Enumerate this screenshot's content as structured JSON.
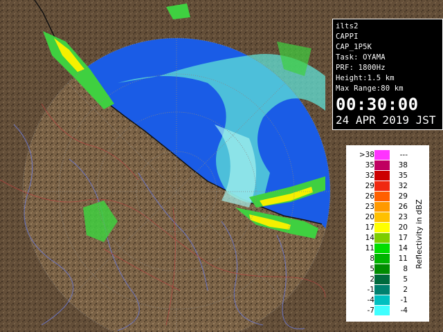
{
  "info": {
    "site": "ilts2",
    "product": "CAPPI",
    "scan": "CAP_1P5K",
    "task": "Task: OYAMA",
    "prf": "PRF: 1800Hz",
    "height": "Height:1.5 km",
    "max_range": "Max Range:80 km",
    "time": "00:30:00",
    "date": "24 APR 2019 JST"
  },
  "legend": {
    "title": "Reflectivity in dBZ",
    "entries": [
      {
        "low": ">38",
        "high": "---",
        "color": "#ff33ff"
      },
      {
        "low": "35",
        "high": "38",
        "color": "#c00060"
      },
      {
        "low": "32",
        "high": "35",
        "color": "#cc0000"
      },
      {
        "low": "29",
        "high": "32",
        "color": "#f02810"
      },
      {
        "low": "26",
        "high": "29",
        "color": "#ff6000"
      },
      {
        "low": "23",
        "high": "26",
        "color": "#ff9900"
      },
      {
        "low": "20",
        "high": "23",
        "color": "#ffc000"
      },
      {
        "low": "17",
        "high": "20",
        "color": "#ffff00"
      },
      {
        "low": "14",
        "high": "17",
        "color": "#7ccd00"
      },
      {
        "low": "11",
        "high": "14",
        "color": "#00dd00"
      },
      {
        "low": "8",
        "high": "11",
        "color": "#00b400"
      },
      {
        "low": "5",
        "high": "8",
        "color": "#008c00"
      },
      {
        "low": "2",
        "high": "5",
        "color": "#006a3c"
      },
      {
        "low": "-1",
        "high": "2",
        "color": "#00806e"
      },
      {
        "low": "-4",
        "high": "-1",
        "color": "#00c0c0"
      },
      {
        "low": "-7",
        "high": "-4",
        "color": "#40ffff"
      }
    ]
  },
  "colors": {
    "sea": "#1a5ce6",
    "land": "#7a6246",
    "echo_cyan": "#5fe0d6",
    "echo_green": "#3fd040",
    "echo_yellow": "#f5f000",
    "grid_line": "#888888"
  }
}
